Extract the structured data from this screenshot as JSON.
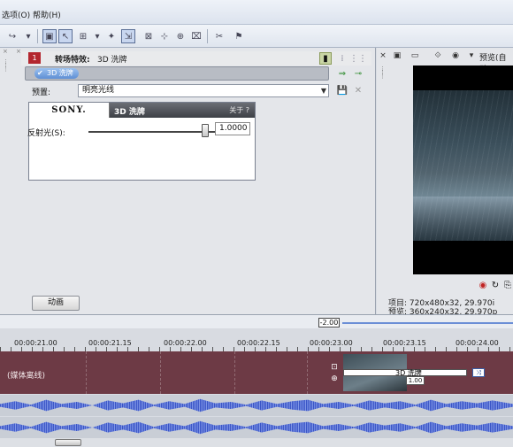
{
  "menu": {
    "options": "选项(O)",
    "help": "帮助(H)"
  },
  "fx": {
    "badge": "1",
    "title": "转场特效:",
    "name": "3D 洗牌",
    "chain_item": "3D 洗牌",
    "preset_label": "预置:",
    "preset_value": "明亮光线",
    "brand": "SONY.",
    "card_name": "3D 洗牌",
    "about": "关于 ?",
    "reflection_label": "反射光(S):",
    "reflection_value": "1.0000",
    "reflection_level": 0.8,
    "animate_button": "动画"
  },
  "preview": {
    "mode_label": "预览(自动",
    "project_info": "项目: 720x480x32, 29.970i",
    "preview_info": "预览: 360x240x32, 29.970p"
  },
  "timeline": {
    "marker": "-2.00",
    "ticks": [
      "00:00:21.00",
      "00:00:21.15",
      "00:00:22.00",
      "00:00:22.15",
      "00:00:23.00",
      "00:00:23.15",
      "00:00:24.00"
    ],
    "track_label": "(媒体离线)",
    "transition_name": "3D 洗牌",
    "transition_duration": "1.00"
  },
  "icons": {
    "chain_add": "plug-add-icon",
    "chain_remove": "remove-icon",
    "save_preset": "save-icon",
    "delete_preset": "delete-icon"
  },
  "colors": {
    "track": "#6d3a45",
    "accent_red": "#b3262e",
    "waveform": "#3f59c8"
  }
}
